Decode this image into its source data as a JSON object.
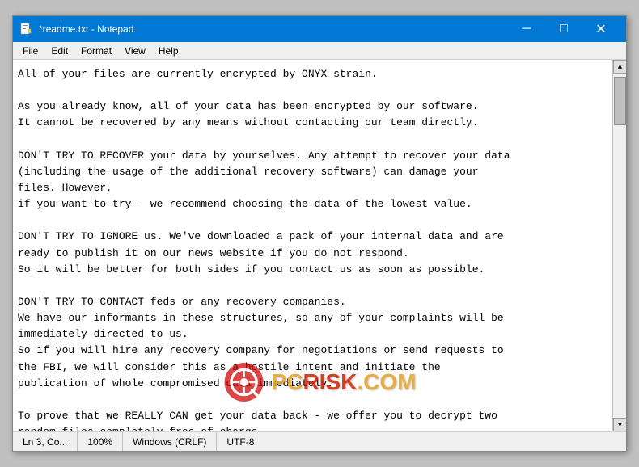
{
  "window": {
    "title": "*readme.txt - Notepad",
    "icon": "notepad"
  },
  "menu": {
    "items": [
      "File",
      "Edit",
      "Format",
      "View",
      "Help"
    ]
  },
  "content": {
    "text": "All of your files are currently encrypted by ONYX strain.\n\nAs you already know, all of your data has been encrypted by our software.\nIt cannot be recovered by any means without contacting our team directly.\n\nDON'T TRY TO RECOVER your data by yourselves. Any attempt to recover your data\n(including the usage of the additional recovery software) can damage your\nfiles. However,\nif you want to try - we recommend choosing the data of the lowest value.\n\nDON'T TRY TO IGNORE us. We've downloaded a pack of your internal data and are\nready to publish it on our news website if you do not respond.\nSo it will be better for both sides if you contact us as soon as possible.\n\nDON'T TRY TO CONTACT feds or any recovery companies.\nWe have our informants in these structures, so any of your complaints will be\nimmediately directed to us.\nSo if you will hire any recovery company for negotiations or send requests to\nthe FBI, we will consider this as a hostile intent and initiate the\npublication of whole compromised data immediately.\n\nTo prove that we REALLY CAN get your data back - we offer you to decrypt two\nrandom files completely free of charge."
  },
  "status_bar": {
    "position": "Ln 3, Co...",
    "zoom": "100%",
    "line_ending": "Windows (CRLF)",
    "encoding": "UTF-8"
  },
  "title_bar": {
    "minimize": "─",
    "maximize": "□",
    "close": "✕"
  },
  "watermark": {
    "text": "RISK.COM"
  }
}
